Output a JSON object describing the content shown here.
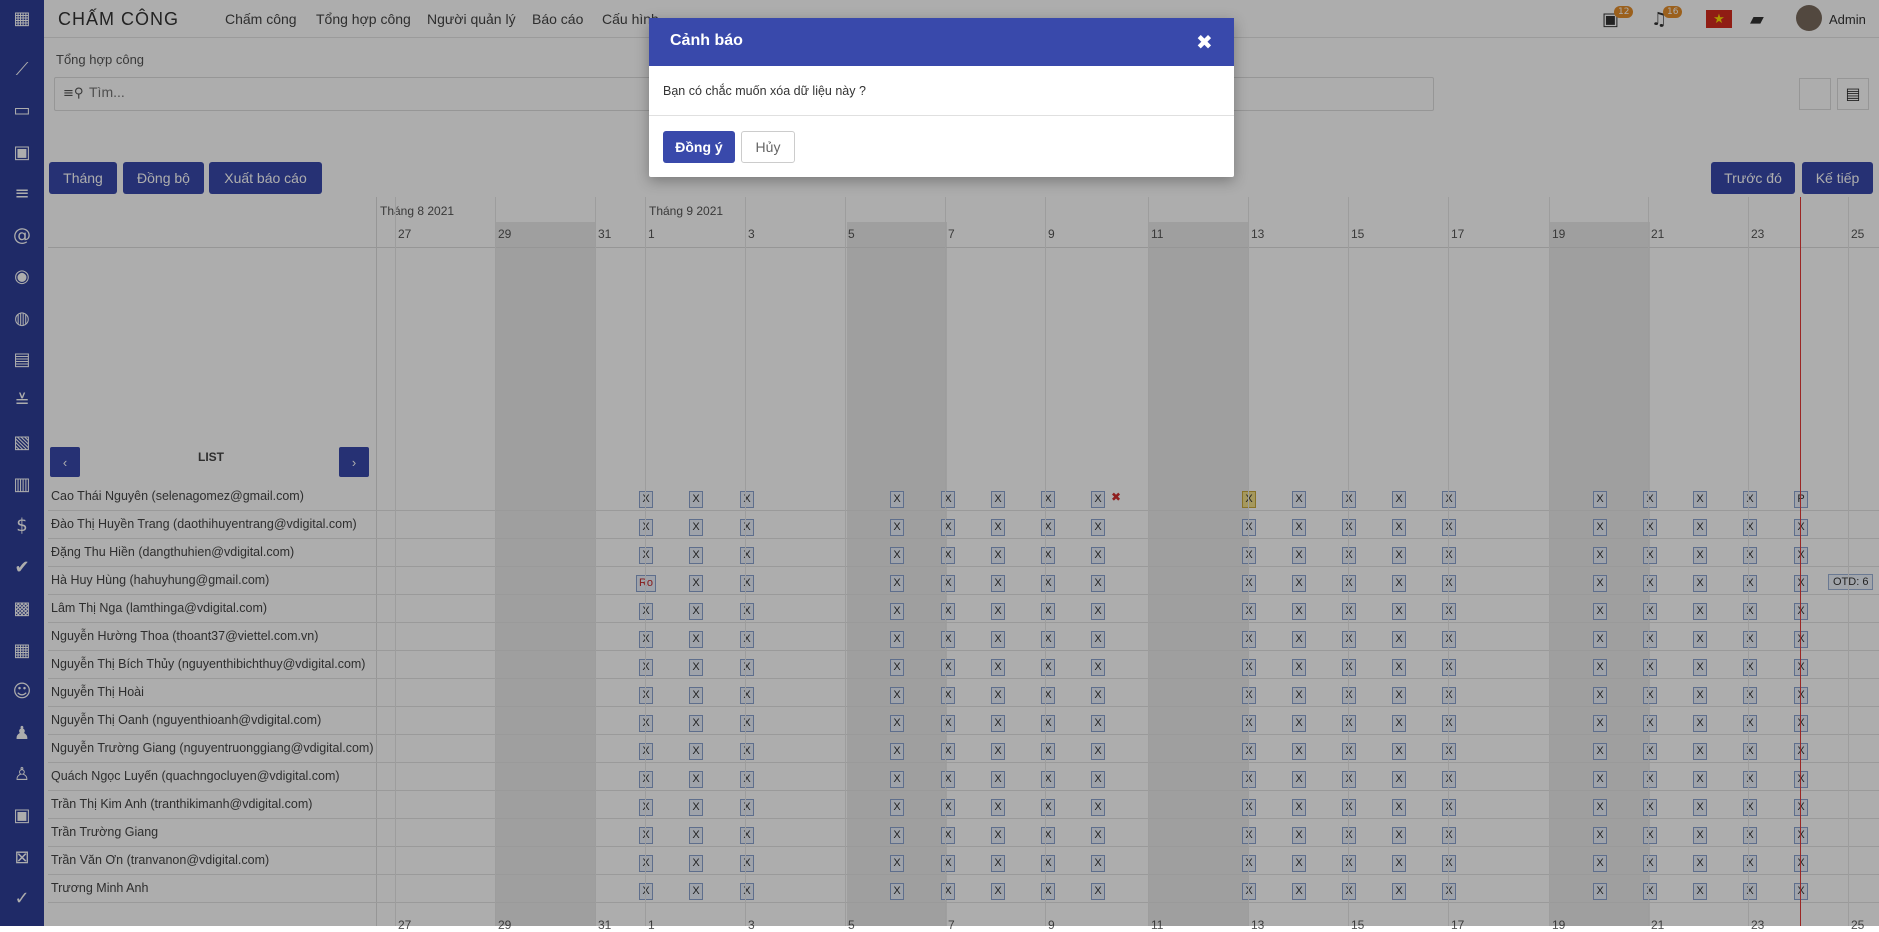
{
  "app": {
    "title": "CHẤM CÔNG"
  },
  "nav": [
    "Chấm công",
    "Tổng hợp công",
    "Người quản lý",
    "Báo cáo",
    "Cấu hình"
  ],
  "topbar": {
    "calendar_badge": "12",
    "bell_badge": "16",
    "user_name": "Admin"
  },
  "breadcrumb": "Tổng hợp công",
  "search": {
    "placeholder": "Tìm..."
  },
  "toolbar": {
    "month": "Tháng",
    "sync": "Đồng bộ",
    "export": "Xuất báo cáo",
    "prev": "Trước đó",
    "next": "Kế tiếp"
  },
  "timeline": {
    "months": [
      "Tháng 8 2021",
      "Tháng 9 2021"
    ],
    "days": [
      "27",
      "29",
      "31",
      "1",
      "3",
      "5",
      "7",
      "9",
      "11",
      "13",
      "15",
      "17",
      "19",
      "21",
      "23",
      "25"
    ],
    "list_label": "LIST",
    "pager_prev": "‹",
    "pager_next": "›",
    "otd_label": "OTD: 6"
  },
  "employees": [
    "Cao Thái Nguyên (selenagomez@gmail.com)",
    "Đào Thị Huyền Trang (daothihuyentrang@vdigital.com)",
    "Đặng Thu Hiền (dangthuhien@vdigital.com)",
    "Hà Huy Hùng (hahuyhung@gmail.com)",
    "Lâm Thị Nga (lamthinga@vdigital.com)",
    "Nguyễn Hường Thoa (thoant37@viettel.com.vn)",
    "Nguyễn Thị Bích Thủy (nguyenthibichthuy@vdigital.com)",
    "Nguyễn Thị Hoài",
    "Nguyễn Thị Oanh (nguyenthioanh@vdigital.com)",
    "Nguyễn Trường Giang (nguyentruonggiang@vdigital.com)",
    "Quách Ngọc Luyến (quachngocluyen@vdigital.com)",
    "Trần Thị Kim Anh (tranthikimanh@vdigital.com)",
    "Trần Trường Giang",
    "Trần Văn Ơn (tranvanon@vdigital.com)",
    "Trương Minh Anh"
  ],
  "marks": {
    "default": "X",
    "ro": "Ro",
    "p": "P",
    "delete": "✖"
  },
  "modal": {
    "title": "Cảnh báo",
    "close": "✖",
    "message": "Bạn có chắc muốn xóa dữ liệu này ?",
    "ok": "Đồng ý",
    "cancel": "Hủy"
  },
  "colors": {
    "primary": "#3949ab",
    "sidebar": "#2f3f99",
    "today_line": "#e53935",
    "badge": "#e58e2a"
  }
}
